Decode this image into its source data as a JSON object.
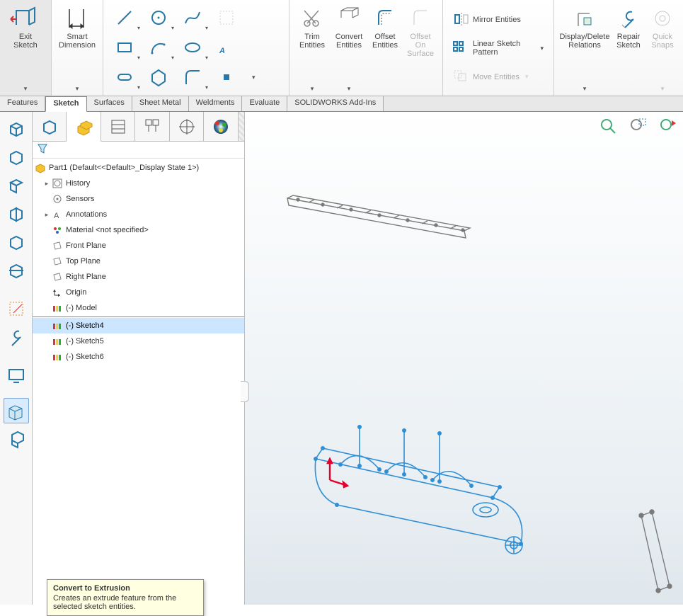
{
  "ribbon": {
    "exit_sketch": "Exit\nSketch",
    "smart_dim": "Smart\nDimension",
    "trim": "Trim\nEntities",
    "convert": "Convert\nEntities",
    "offset": "Offset\nEntities",
    "offset_surface": "Offset\nOn\nSurface",
    "mirror": "Mirror Entities",
    "linear_pattern": "Linear Sketch Pattern",
    "move": "Move Entities",
    "display_rel": "Display/Delete\nRelations",
    "repair": "Repair\nSketch",
    "quick_snaps": "Quick\nSnaps"
  },
  "tabs": [
    "Features",
    "Sketch",
    "Surfaces",
    "Sheet Metal",
    "Weldments",
    "Evaluate",
    "SOLIDWORKS Add-Ins"
  ],
  "active_tab": "Sketch",
  "tree": {
    "root": "Part1  (Default<<Default>_Display State 1>)",
    "history": "History",
    "sensors": "Sensors",
    "annotations": "Annotations",
    "material": "Material <not specified>",
    "front_plane": "Front Plane",
    "top_plane": "Top Plane",
    "right_plane": "Right Plane",
    "origin": "Origin",
    "model": "(-) Model",
    "sketch4": "(-) Sketch4",
    "sketch5": "(-) Sketch5",
    "sketch6": "(-) Sketch6"
  },
  "tooltip": {
    "title": "Convert to Extrusion",
    "body": "Creates an extrude feature from the selected sketch entities."
  }
}
